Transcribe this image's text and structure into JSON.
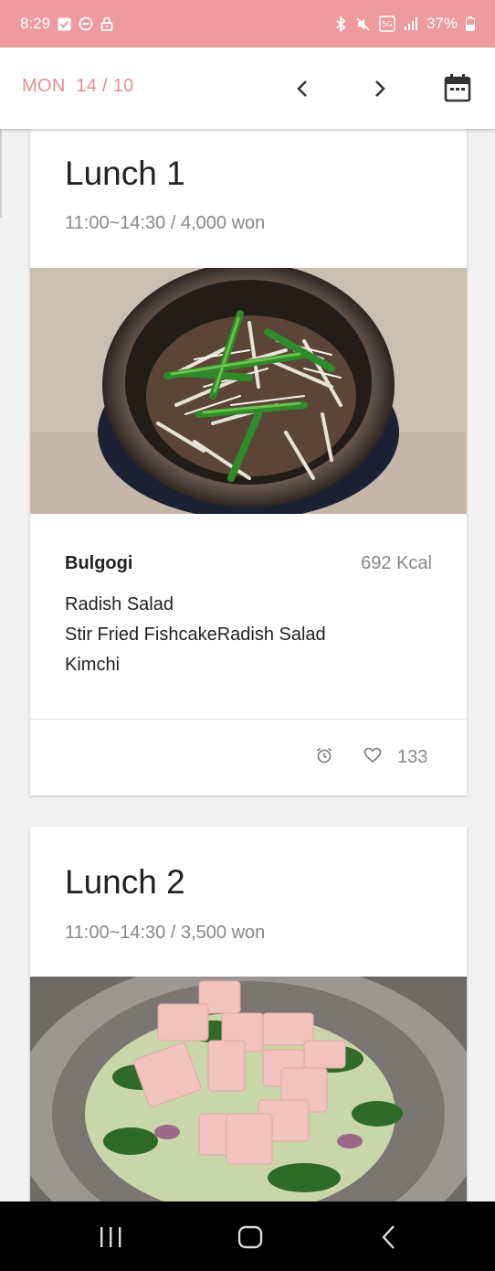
{
  "status_bar": {
    "time": "8:29",
    "battery": "37%",
    "left_icons": [
      "checkbox-icon",
      "do-not-disturb-icon",
      "lock-icon"
    ],
    "right_icons": [
      "bluetooth-icon",
      "mute-icon",
      "5g-lte-icon",
      "signal-icon",
      "battery-icon"
    ]
  },
  "header": {
    "day": "MON",
    "date": "14 / 10",
    "prev_icon": "chevron-left-icon",
    "next_icon": "chevron-right-icon",
    "calendar_icon": "calendar-icon",
    "accent_color": "#e38f94",
    "status_color": "#ee9ba0"
  },
  "menus": [
    {
      "title": "Lunch 1",
      "info": "11:00~14:30 / 4,000 won",
      "photo": "bulgogi-stone-pot-photo",
      "main_dish": "Bulgogi",
      "kcal": "692 Kcal",
      "sides": [
        "Radish Salad",
        "Stir Fried FishcakeRadish Salad",
        "Kimchi"
      ],
      "likes": "133"
    },
    {
      "title": "Lunch 2",
      "info": "11:00~14:30 / 3,500 won",
      "photo": "salad-bowl-photo"
    }
  ],
  "nav_bar": {
    "icons": [
      "recents-icon",
      "home-icon",
      "back-icon"
    ]
  }
}
